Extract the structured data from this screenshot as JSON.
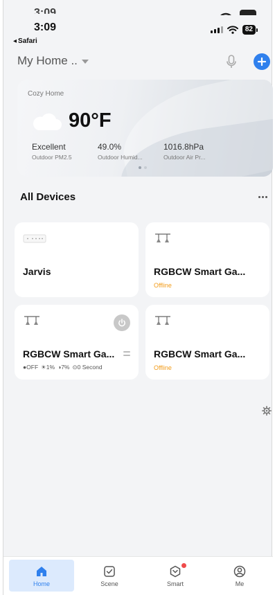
{
  "status_bar": {
    "ghost_time": "3:09",
    "time": "3:09",
    "back_label": "Safari",
    "battery": "82"
  },
  "header": {
    "home_name": "My Home .."
  },
  "weather": {
    "home_label": "Cozy Home",
    "temperature": "90°F",
    "metrics": [
      {
        "value": "Excellent",
        "label": "Outdoor PM2.5"
      },
      {
        "value": "49.0%",
        "label": "Outdoor Humid..."
      },
      {
        "value": "1016.8hPa",
        "label": "Outdoor Air Pr..."
      }
    ]
  },
  "devices": {
    "title": "All Devices",
    "items": [
      {
        "name": "Jarvis",
        "status": ""
      },
      {
        "name": "RGBCW Smart Ga...",
        "status": "Offline"
      },
      {
        "name": "RGBCW Smart Ga...",
        "status": "",
        "detail": {
          "power": "OFF",
          "brightness": "1%",
          "temp": "7%",
          "timer": "0 Second"
        }
      },
      {
        "name": "RGBCW Smart Ga...",
        "status": "Offline"
      }
    ]
  },
  "tabs": [
    {
      "label": "Home",
      "icon": "home-icon"
    },
    {
      "label": "Scene",
      "icon": "scene-icon"
    },
    {
      "label": "Smart",
      "icon": "smart-icon"
    },
    {
      "label": "Me",
      "icon": "me-icon"
    }
  ],
  "colors": {
    "accent": "#2f80ed",
    "offline": "#f29b18",
    "badge": "#ef4b4b"
  }
}
